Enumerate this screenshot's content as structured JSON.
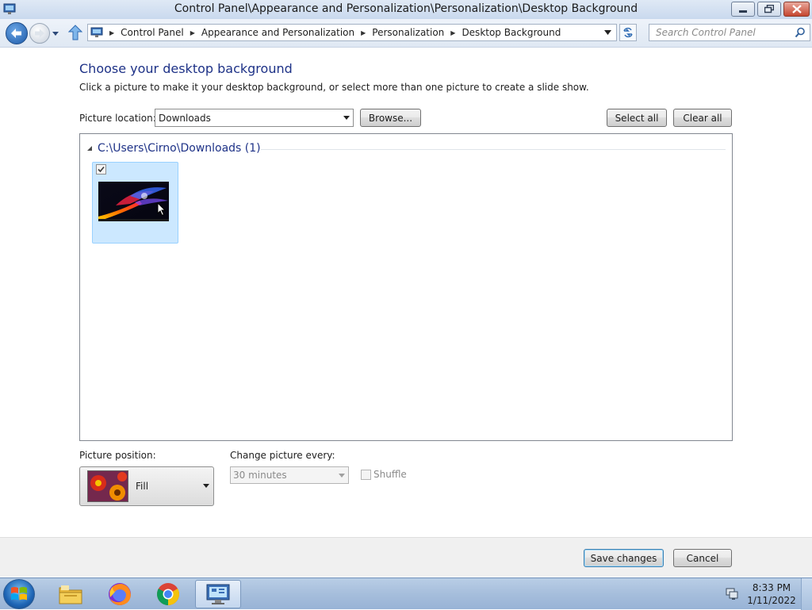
{
  "window": {
    "title": "Control Panel\\Appearance and Personalization\\Personalization\\Desktop Background"
  },
  "address": {
    "crumbs": [
      "Control Panel",
      "Appearance and Personalization",
      "Personalization",
      "Desktop Background"
    ]
  },
  "search": {
    "placeholder": "Search Control Panel"
  },
  "page": {
    "title": "Choose your desktop background",
    "subtitle": "Click a picture to make it your desktop background, or select more than one picture to create a slide show."
  },
  "location": {
    "label": "Picture location:",
    "value": "Downloads",
    "browse_label": "Browse...",
    "select_all_label": "Select all",
    "clear_all_label": "Clear all"
  },
  "pictures": {
    "group_title": "C:\\Users\\Cirno\\Downloads (1)",
    "items": [
      {
        "checked": true
      }
    ]
  },
  "position": {
    "label": "Picture position:",
    "value": "Fill"
  },
  "interval": {
    "label": "Change picture every:",
    "value": "30 minutes",
    "shuffle_label": "Shuffle",
    "shuffle_checked": false
  },
  "footer": {
    "save_label": "Save changes",
    "cancel_label": "Cancel"
  },
  "taskbar": {
    "apps": [
      "windows-explorer",
      "firefox",
      "chrome",
      "control-panel"
    ],
    "time": "8:33 PM",
    "date": "1/11/2022"
  },
  "colors": {
    "title_blue": "#1e3287",
    "selection_fill": "#cce8ff",
    "selection_border": "#99d1ff",
    "taskbar": "#a6bedc"
  }
}
